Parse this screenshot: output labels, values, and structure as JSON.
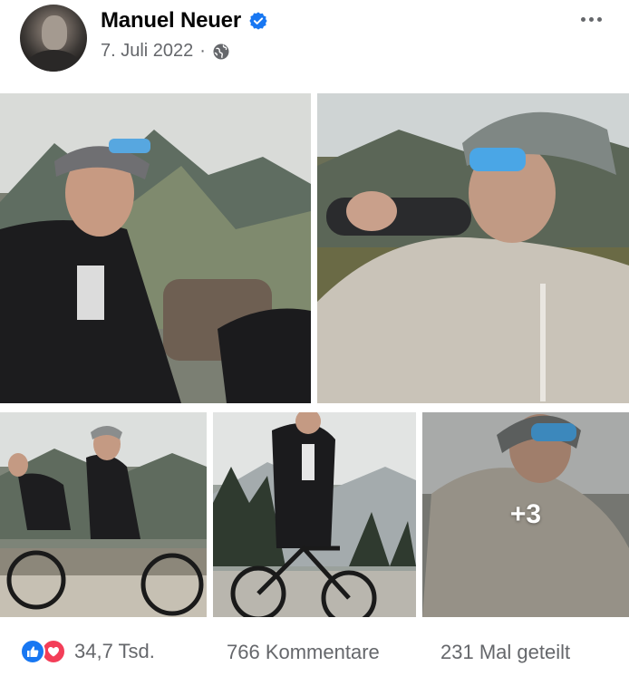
{
  "post": {
    "author": "Manuel Neuer",
    "date": "7. Juli 2022",
    "separator": "·",
    "audience_icon": "globe-icon",
    "verified_icon": "verified-badge-icon",
    "menu_icon": "more-options-icon"
  },
  "photos": {
    "extra_count": "+3"
  },
  "engagement": {
    "reactions_count": "34,7 Tsd.",
    "reaction_icons": [
      "like-icon",
      "love-icon"
    ],
    "comments": "766 Kommentare",
    "shares": "231 Mal geteilt"
  },
  "colors": {
    "verified_blue": "#1877f2",
    "like_blue": "#1877f2",
    "love_red": "#f33e58",
    "secondary_text": "#65676b"
  }
}
